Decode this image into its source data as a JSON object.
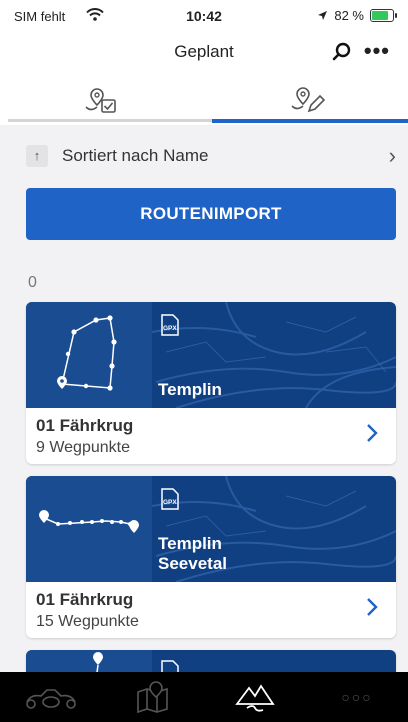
{
  "status": {
    "carrier": "SIM fehlt",
    "time": "10:42",
    "battery": "82 %",
    "battery_level": 0.82
  },
  "nav": {
    "title": "Geplant",
    "search_icon": "search-icon",
    "more_icon": "more-icon",
    "more_label": "•••"
  },
  "tabs": [
    {
      "icon": "waypoint-check-icon",
      "active": false
    },
    {
      "icon": "waypoint-edit-icon",
      "active": true
    }
  ],
  "sort": {
    "arrow": "↑",
    "label": "Sortiert nach Name",
    "chevron": "›"
  },
  "import_button": "ROUTENIMPORT",
  "count": "0",
  "cards": [
    {
      "places": [
        "Templin"
      ],
      "name": "01 Fährkrug",
      "waypoints": "9 Wegpunkte",
      "badge": "GPX"
    },
    {
      "places": [
        "Templin",
        "Seevetal"
      ],
      "name": "01 Fährkrug",
      "waypoints": "15 Wegpunkte",
      "badge": "GPX"
    }
  ],
  "bottom_nav": [
    {
      "icon": "motorcycle-icon"
    },
    {
      "icon": "map-icon"
    },
    {
      "icon": "mountain-route-icon",
      "active": true
    },
    {
      "icon": "more-icon",
      "label": "○○○"
    }
  ],
  "colors": {
    "accent": "#1f63c6",
    "map": "#103f82",
    "bottom_bar": "#000000"
  }
}
